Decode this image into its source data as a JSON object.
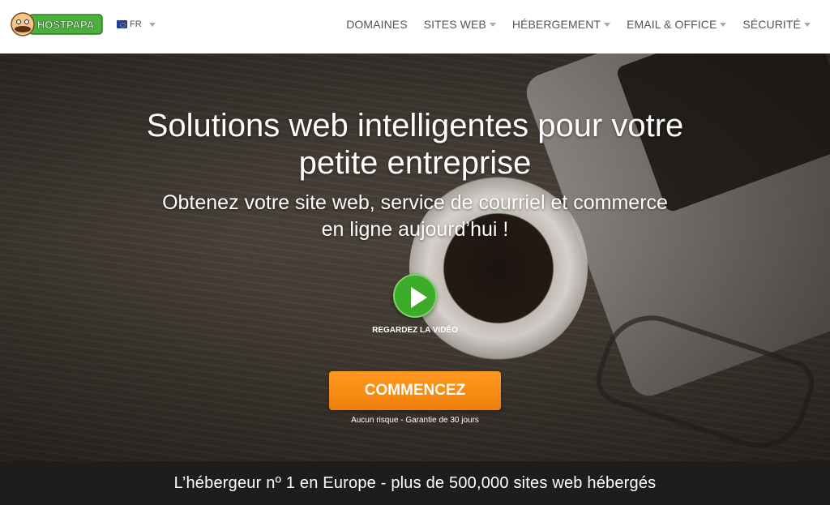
{
  "header": {
    "logo_text": "HOSTPAPA",
    "language": {
      "code": "FR"
    },
    "nav": [
      {
        "label": "DOMAINES",
        "has_dropdown": false
      },
      {
        "label": "SITES WEB",
        "has_dropdown": true
      },
      {
        "label": "HÉBERGEMENT",
        "has_dropdown": true
      },
      {
        "label": "EMAIL & OFFICE",
        "has_dropdown": true
      },
      {
        "label": "SÉCURITÉ",
        "has_dropdown": true
      }
    ]
  },
  "hero": {
    "title_line1": "Solutions web intelligentes pour votre",
    "title_line2": "petite entreprise",
    "subtitle_line1": "Obtenez votre site web, service de courriel et commerce",
    "subtitle_line2": "en ligne aujourd’hui !",
    "video_label": "REGARDEZ LA VIDÉO",
    "cta_label": "COMMENCEZ",
    "cta_note": "Aucun risque - Garantie de 30 jours"
  },
  "bottom_bar": {
    "text": "L’hébergeur nº 1 en Europe - plus de 500,000 sites web hébergés"
  },
  "colors": {
    "accent_green": "#3cab2a",
    "cta_orange": "#f7890f",
    "nav_text": "#555555",
    "bottom_bar": "#1f1d1c"
  }
}
